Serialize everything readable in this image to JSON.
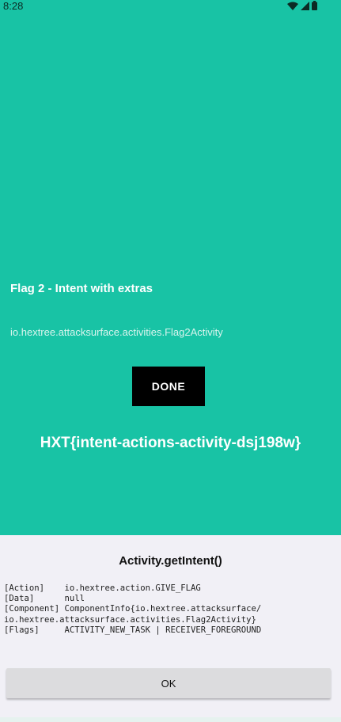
{
  "status_bar": {
    "time": "8:28",
    "icons": [
      "wifi-icon",
      "cell-signal-icon",
      "battery-icon"
    ]
  },
  "screen": {
    "title": "Flag 2 - Intent with extras",
    "activity": "io.hextree.attacksurface.activities.Flag2Activity",
    "done_label": "DONE",
    "flag": "HXT{intent-actions-activity-dsj198w}"
  },
  "dialog": {
    "title": "Activity.getIntent()",
    "lines": [
      "[Action]    io.hextree.action.GIVE_FLAG",
      "[Data]      null",
      "[Component] ComponentInfo{io.hextree.attacksurface/",
      "io.hextree.attacksurface.activities.Flag2Activity}",
      "[Flags]     ACTIVITY_NEW_TASK | RECEIVER_FOREGROUND"
    ],
    "ok_label": "OK"
  },
  "colors": {
    "accent": "#18c3a5",
    "sheet_background": "#f1f0f6",
    "button_dark": "#000000"
  }
}
